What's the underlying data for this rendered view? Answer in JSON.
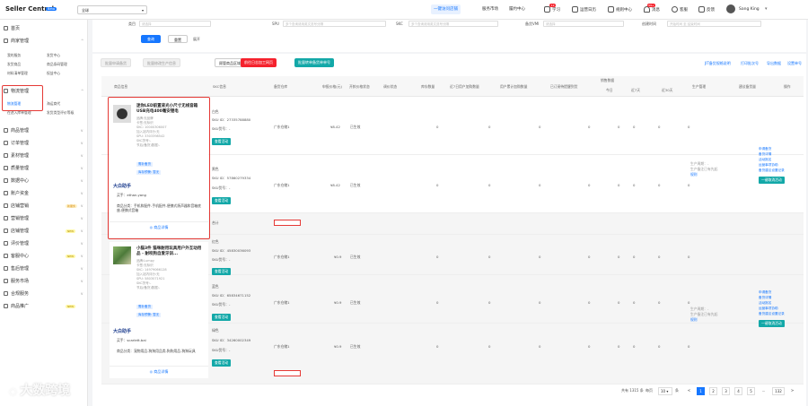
{
  "topbar": {
    "brand": "Seller Central",
    "brand_badge": "Beta",
    "shop_select": "全球",
    "primary_btn": "一键访问店铺",
    "links": [
      "服务市场",
      "履约中心"
    ],
    "items": [
      {
        "label": "学习",
        "badge": "12"
      },
      {
        "label": "运营日历",
        "badge": ""
      },
      {
        "label": "规则中心",
        "badge": ""
      },
      {
        "label": "消息",
        "badge": "99+"
      },
      {
        "label": "客服",
        "badge": ""
      },
      {
        "label": "反馈",
        "badge": ""
      }
    ],
    "user": "Sang King"
  },
  "sidebar": {
    "items": [
      {
        "label": "首页"
      },
      {
        "label": "商家管理"
      },
      {
        "label": "物流管理"
      },
      {
        "label": "商品管理"
      },
      {
        "label": "订单管理"
      },
      {
        "label": "素材管理"
      },
      {
        "label": "质量管理"
      },
      {
        "label": "数据中心"
      },
      {
        "label": "账户资金"
      },
      {
        "label": "店铺营销",
        "tag": "新服务"
      },
      {
        "label": "营销管理"
      },
      {
        "label": "店铺管理",
        "tag": "NEW"
      },
      {
        "label": "评价管理"
      },
      {
        "label": "客服中心",
        "tag": "NEW"
      },
      {
        "label": "售后管理"
      },
      {
        "label": "服务市场"
      },
      {
        "label": "合规服务"
      },
      {
        "label": "商品推广",
        "tag": "NEW"
      }
    ],
    "subs_group1": [
      "我的服务",
      "发货中心",
      "发货商品",
      "商品条码管理",
      "材料清单管理",
      "权益中心"
    ],
    "subs_group2": [
      "物流管理",
      "海运商代",
      "在途入库单管理",
      "发货类型评价等级"
    ]
  },
  "filters": {
    "labels": [
      "类目",
      "SPU",
      "SKC",
      "备货VMI",
      "创建时间"
    ],
    "placeholders": [
      "请选择",
      "多个查询请用英文逗号分隔",
      "多个查询请用英文逗号分隔",
      "请选择",
      "开始时间 至 结束时间"
    ],
    "search_btn": "查询",
    "reset_btn": "重置",
    "expand": "展开"
  },
  "actions": {
    "buttons": [
      "批量申请备货",
      "批量修改生产信息",
      "顾管商品区域设置",
      "前往日志加工网页",
      "批量转单备货单单号"
    ],
    "right_links": [
      "JIT备货规格说明",
      "打印批次号",
      "导出数据",
      "设置单号"
    ]
  },
  "table": {
    "headers": [
      "商品信息",
      "SKC信息",
      "备货仓库",
      "申报价格(元)",
      "开款价格状态",
      "调价状态",
      "库存数量",
      "近7日用户加购数量",
      "用户累计加购数量",
      "已订阅待提醒到货",
      "待发数量",
      "今日",
      "近7天",
      "近30天",
      "生产管理",
      "建议备货量",
      "操作"
    ],
    "group_header": "销售数据"
  },
  "products": [
    {
      "title": "迷你LED前置背光小尺寸无线音箱 USB充电400毫安锂电",
      "meta": [
        "品牌:无品牌",
        "卡签:无标识",
        "SKC: 10000306007",
        "加入站内评分:无",
        "SPU: 3303398542",
        "SKC货号:-",
        "节后(备货)数据:-"
      ],
      "tags": [
        "需补备货",
        "库存预警: 暂无"
      ],
      "assistant": "大白助手",
      "buyer": "买手：ethan.yang",
      "category": "商品分类：手机和配件-手机配件-便携式扬声器和音箱底座-便携式音箱",
      "detail": "商品详情",
      "skus": [
        {
          "color": "白色",
          "sku_id": "SKU ID：27335788880",
          "sku_no": "SKU货号：-",
          "btn": "查看活动",
          "warehouse": "广东仓储1",
          "price": "¥8.42",
          "status": "已生效",
          "v1": "0",
          "v2": "0",
          "v3": "0",
          "v4": "0",
          "v5": "0",
          "v6": "0",
          "v7": "0",
          "v8": "0"
        },
        {
          "color": "黑色",
          "sku_id": "SKU ID：57860279334",
          "sku_no": "SKU货号：-",
          "btn": "查看活动",
          "warehouse": "广东仓储1",
          "price": "¥8.42",
          "status": "已生效",
          "v1": "0",
          "v2": "0",
          "v3": "0",
          "v4": "0",
          "v5": "0",
          "v6": "0",
          "v7": "0",
          "v8": "0"
        }
      ],
      "total_label": "合计",
      "ops": [
        "申请备货",
        "备货详情",
        "活动报名",
        "运营事项协助",
        "备货建议设置记录"
      ],
      "ops_btn": "一键取消活动",
      "prod_notes": [
        "生产周期：-",
        "生产备注已有先起",
        "规则"
      ]
    },
    {
      "title": "小猫3件 猫咪耐用玩具用户外互动用品 - 耐咬狗自爱牙训...",
      "meta": [
        "品牌:Lumpy",
        "卡签:无标识",
        "SKC: 14979066128",
        "加入站内评分:无",
        "SPU: 5803071921",
        "SKC货号:-",
        "节后(备货)数据:-"
      ],
      "tags": [
        "需补备货",
        "库存预警: 暂无"
      ],
      "assistant": "大白助手",
      "buyer": "买手：scarlett.bai",
      "category": "商品分类：宠物用品-狗狗用品类-狗狗用品-狗狗玩具",
      "detail": "商品详情",
      "skus": [
        {
          "color": "红色",
          "sku_id": "SKU ID：45830036093",
          "sku_no": "SKU货号：-",
          "btn": "查看活动",
          "warehouse": "广东仓储1",
          "price": "¥0.9",
          "status": "已生效",
          "v1": "0",
          "v2": "0",
          "v3": "0",
          "v4": "0",
          "v5": "0",
          "v6": "0",
          "v7": "0",
          "v8": "0"
        },
        {
          "color": "蓝色",
          "sku_id": "SKU ID：65834671152",
          "sku_no": "SKU货号：-",
          "btn": "查看活动",
          "warehouse": "广东仓储1",
          "price": "¥0.9",
          "status": "已生效",
          "v1": "0",
          "v2": "0",
          "v3": "0",
          "v4": "0",
          "v5": "0",
          "v6": "0",
          "v7": "0",
          "v8": "0"
        },
        {
          "color": "绿色",
          "sku_id": "SKU ID：34260002349",
          "sku_no": "SKU货号：-",
          "btn": "查看活动",
          "warehouse": "广东仓储1",
          "price": "¥0.9",
          "status": "已生效",
          "v1": "0",
          "v2": "0",
          "v3": "0",
          "v4": "0",
          "v5": "0",
          "v6": "0",
          "v7": "0",
          "v8": "0"
        }
      ],
      "ops": [
        "申请备货",
        "备货详情",
        "活动报名",
        "运营事项协助",
        "备货建议设置记录"
      ],
      "ops_btn": "一键取消活动",
      "prod_notes": [
        "生产周期：-",
        "生产备注已有先起",
        "规则"
      ]
    }
  ],
  "pager": {
    "total": "共有 1315 条",
    "per_page_label": "每页",
    "per_page": "10",
    "unit": "条",
    "pages": [
      "1",
      "2",
      "3",
      "4",
      "5",
      "...",
      "132"
    ],
    "prev": "<",
    "next": ">"
  },
  "watermark": "大数跨境",
  "colors": {
    "primary": "#1677ff",
    "danger": "#f5222d",
    "teal": "#13a8a8",
    "highlight_box": "#e53935"
  }
}
